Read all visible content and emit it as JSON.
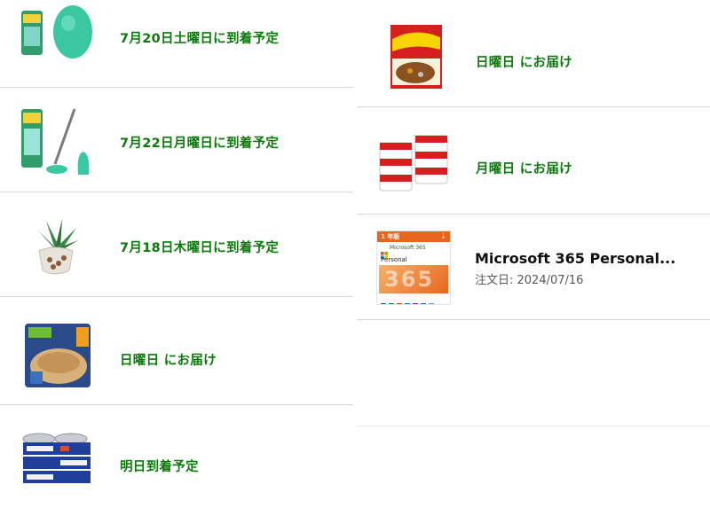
{
  "left_orders": [
    {
      "status": "7月20日土曜日に到着予定",
      "image": "sponge-refill-icon"
    },
    {
      "status": "7月22日月曜日に到着予定",
      "image": "scrub-brush-icon"
    },
    {
      "status": "7月18日木曜日に到着予定",
      "image": "potted-plant-icon"
    },
    {
      "status": "日曜日 にお届け",
      "image": "soup-pouch-icon"
    },
    {
      "status": "明日到着予定",
      "image": "tuna-cans-icon"
    }
  ],
  "right_orders": [
    {
      "status": "日曜日 にお届け",
      "image": "curry-box-icon"
    },
    {
      "status": "月曜日 にお届け",
      "image": "rice-packs-icon"
    },
    {
      "title": "Microsoft 365 Personal...",
      "date": "注文日: 2024/07/16",
      "image": "microsoft-365-box-icon",
      "box_badge": "1 年版",
      "box_brand": "Microsoft 365",
      "box_edition": "Personal",
      "box_digits": "365"
    }
  ],
  "colors": {
    "status_green": "#0b7a0b",
    "separator": "#d5d9d9"
  }
}
